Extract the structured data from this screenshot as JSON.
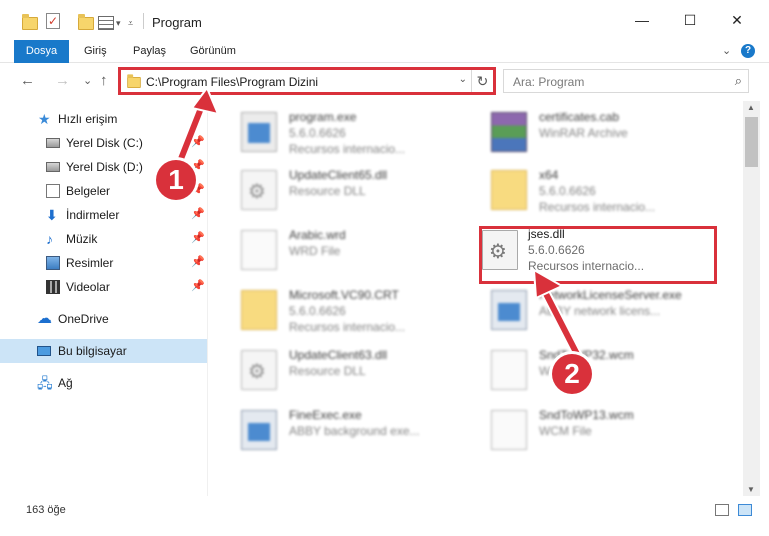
{
  "window": {
    "title": "Program",
    "controls": {
      "minimize": "—",
      "maximize": "☐",
      "close": "✕"
    }
  },
  "ribbon": {
    "file_tab": "Dosya",
    "tabs": [
      "Giriş",
      "Paylaş",
      "Görünüm"
    ],
    "expand_icon": "chevron-down-icon",
    "help_label": "?"
  },
  "nav": {
    "back": "←",
    "forward": "→",
    "recent": "⌄",
    "up": "↑",
    "address_path": "C:\\Program Files\\Program Dizini",
    "refresh": "↻",
    "search_placeholder": "Ara: Program"
  },
  "sidebar": {
    "items": [
      {
        "label": "Hızlı erişim",
        "icon": "star-icon",
        "pinned": false
      },
      {
        "label": "Yerel Disk (C:)",
        "icon": "disk-icon",
        "pinned": true
      },
      {
        "label": "Yerel Disk (D:)",
        "icon": "disk-icon",
        "pinned": true
      },
      {
        "label": "Belgeler",
        "icon": "document-icon",
        "pinned": true
      },
      {
        "label": "İndirmeler",
        "icon": "download-icon",
        "pinned": true
      },
      {
        "label": "Müzik",
        "icon": "music-icon",
        "pinned": true
      },
      {
        "label": "Resimler",
        "icon": "pictures-icon",
        "pinned": true
      },
      {
        "label": "Videolar",
        "icon": "video-icon",
        "pinned": true
      },
      {
        "label": "OneDrive",
        "icon": "cloud-icon",
        "pinned": false
      },
      {
        "label": "Bu bilgisayar",
        "icon": "computer-icon",
        "pinned": false,
        "selected": true
      },
      {
        "label": "Ağ",
        "icon": "network-icon",
        "pinned": false
      }
    ]
  },
  "files": [
    {
      "name": "program.exe",
      "sub1": "5.6.0.6626",
      "sub2": "Recursos internacio...",
      "icon": "exe-icon",
      "blurred": true
    },
    {
      "name": "certificates.cab",
      "sub1": "WinRAR Archive",
      "sub2": "",
      "icon": "rar-icon",
      "blurred": true
    },
    {
      "name": "UpdateClient65.dll",
      "sub1": "Resource DLL",
      "sub2": "",
      "icon": "dll-icon",
      "blurred": true
    },
    {
      "name": "x64",
      "sub1": "5.6.0.6626",
      "sub2": "Recursos internacio...",
      "icon": "folder-icon",
      "blurred": true
    },
    {
      "name": "Arabic.wrd",
      "sub1": "WRD File",
      "sub2": "",
      "icon": "file-icon",
      "blurred": true
    },
    {
      "name": "jses.dll",
      "sub1": "5.6.0.6626",
      "sub2": "Recursos internacio...",
      "icon": "dll-icon",
      "blurred": false
    },
    {
      "name": "Microsoft.VC90.CRT",
      "sub1": "5.6.0.6626",
      "sub2": "Recursos internacio...",
      "icon": "folder-icon",
      "blurred": true
    },
    {
      "name": "NetworkLicenseServer.exe",
      "sub1": "ABBY network licens...",
      "sub2": "",
      "icon": "window-icon",
      "blurred": true
    },
    {
      "name": "UpdateClient63.dll",
      "sub1": "Resource DLL",
      "sub2": "",
      "icon": "dll-icon",
      "blurred": true
    },
    {
      "name": "SndToWP32.wcm",
      "sub1": "WCM File",
      "sub2": "",
      "icon": "file-icon",
      "blurred": true
    },
    {
      "name": "FineExec.exe",
      "sub1": "ABBY background exe...",
      "sub2": "",
      "icon": "window-icon",
      "blurred": true
    },
    {
      "name": "SndToWP13.wcm",
      "sub1": "WCM File",
      "sub2": "",
      "icon": "file-icon",
      "blurred": true
    }
  ],
  "status": {
    "item_count": "163 öğe"
  },
  "callouts": {
    "one": "1",
    "two": "2"
  },
  "colors": {
    "accent": "#1979ca",
    "highlight": "#d9313b",
    "selected_bg": "#cce4f7"
  }
}
